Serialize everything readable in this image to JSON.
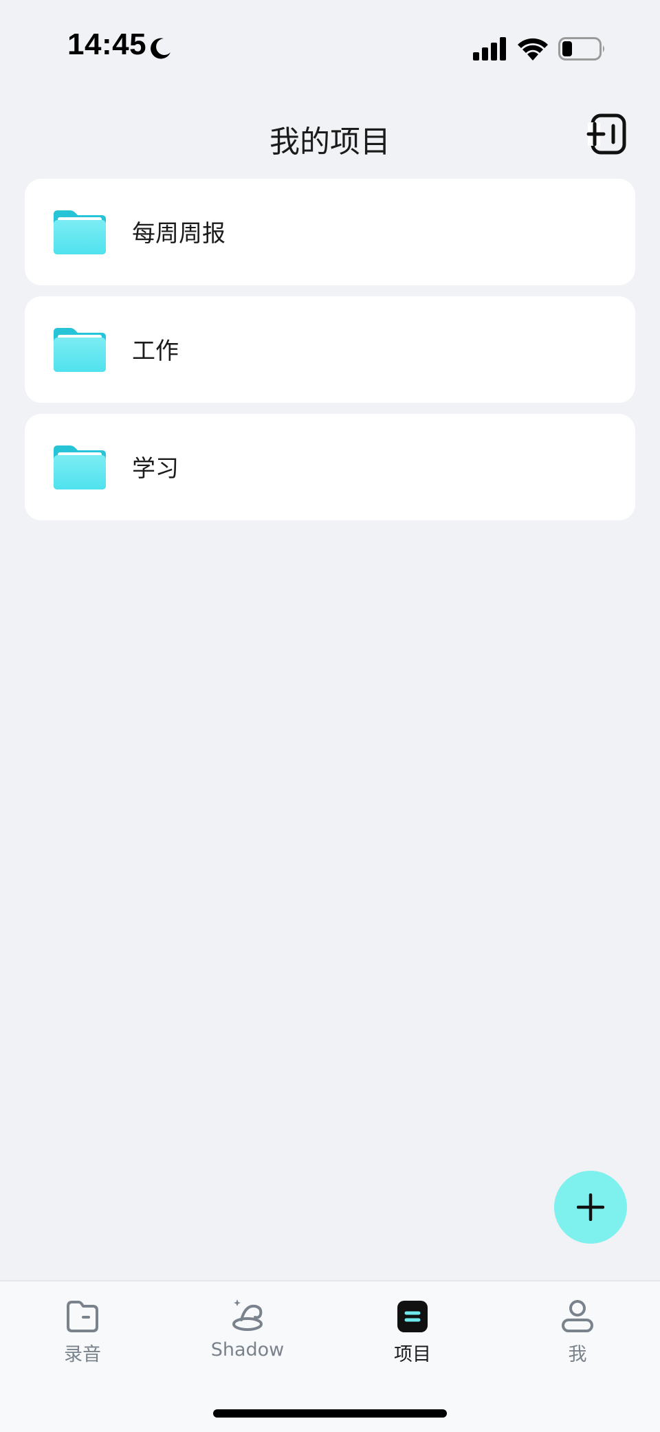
{
  "status_bar": {
    "time": "14:45"
  },
  "header": {
    "title": "我的项目",
    "action_icon": "export-icon"
  },
  "projects": [
    {
      "name": "每周周报",
      "icon": "folder-icon"
    },
    {
      "name": "工作",
      "icon": "folder-icon"
    },
    {
      "name": "学习",
      "icon": "folder-icon"
    }
  ],
  "fab": {
    "icon": "plus-icon"
  },
  "tab_bar": {
    "tabs": [
      {
        "label": "录音",
        "icon": "folder-icon",
        "active": false
      },
      {
        "label": "Shadow",
        "icon": "wizard-hat-icon",
        "active": false
      },
      {
        "label": "项目",
        "icon": "list-icon",
        "active": true
      },
      {
        "label": "我",
        "icon": "user-icon",
        "active": false
      }
    ]
  },
  "colors": {
    "background": "#f0f2f5",
    "card": "#ffffff",
    "accent": "#7ef0ee",
    "folder": "#5fe3ec",
    "tab_inactive": "#7a828c",
    "tab_active": "#1b1b1b"
  }
}
